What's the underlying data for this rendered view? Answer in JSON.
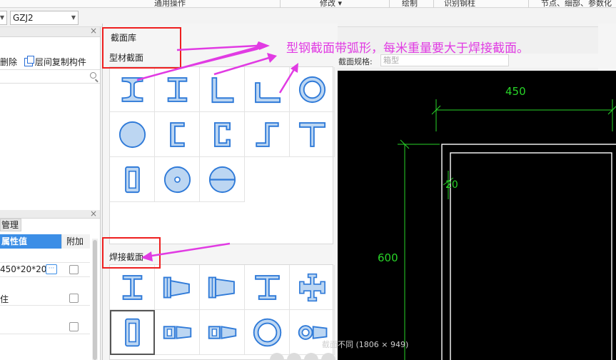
{
  "ribbon": {
    "labels": [
      "通用操作",
      "修改",
      "绘制",
      "识别钢柱",
      "节点、细部、参数化"
    ],
    "modify_chevron": "▾"
  },
  "toolbar": {
    "floor_select": "",
    "component_select": "GZJ2"
  },
  "left_panel": {
    "delete_label": "删除",
    "copy_floor_label": "层间复制构件",
    "search_placeholder": ""
  },
  "property_panel": {
    "tab_label": "管理",
    "col_value": "属性值",
    "col_attach": "附加",
    "rows": [
      {
        "value": "",
        "checkbox": false
      },
      {
        "value": "450*20*20",
        "checkbox": true
      },
      {
        "value": "住",
        "checkbox": true
      },
      {
        "value": "",
        "checkbox": true
      }
    ]
  },
  "dialog": {
    "library_title": "截面库",
    "profile_title": "型材截面",
    "weld_title": "焊接截面",
    "spec_label": "截面规格:",
    "spec_placeholder": "箱型"
  },
  "profile_sections": [
    {
      "icon": "i-beam-icon"
    },
    {
      "icon": "h-beam-icon"
    },
    {
      "icon": "angle-icon"
    },
    {
      "icon": "unequal-angle-icon"
    },
    {
      "icon": "ring-icon"
    },
    {
      "icon": "solid-circle-icon"
    },
    {
      "icon": "channel-open-icon"
    },
    {
      "icon": "channel-icon"
    },
    {
      "icon": "z-section-icon"
    },
    {
      "icon": "t-section-icon"
    },
    {
      "icon": "rect-tube-icon"
    },
    {
      "icon": "perforated-disk-icon"
    },
    {
      "icon": "split-sphere-icon"
    }
  ],
  "weld_sections": [
    {
      "icon": "welded-i-icon"
    },
    {
      "icon": "tapered-i-icon"
    },
    {
      "icon": "tapered-i-icon-2"
    },
    {
      "icon": "welded-h-icon"
    },
    {
      "icon": "cross-section-icon"
    },
    {
      "icon": "box-section-icon"
    },
    {
      "icon": "tapered-box-icon"
    },
    {
      "icon": "tapered-box-icon-2"
    },
    {
      "icon": "pipe-icon"
    },
    {
      "icon": "tapered-pipe-icon"
    }
  ],
  "canvas": {
    "width_label": "450",
    "height_label": "600",
    "thickness_label": "20"
  },
  "annotation": {
    "text": "型钢截面带弧形，每米重量要大于焊接截面。",
    "color": "#e13be3"
  },
  "status": {
    "text": "截面不同 (1806 × 949)"
  },
  "colors": {
    "accent": "#3c8ee6",
    "dimension_green": "#28d428",
    "highlight_red": "#ee1f1f"
  }
}
